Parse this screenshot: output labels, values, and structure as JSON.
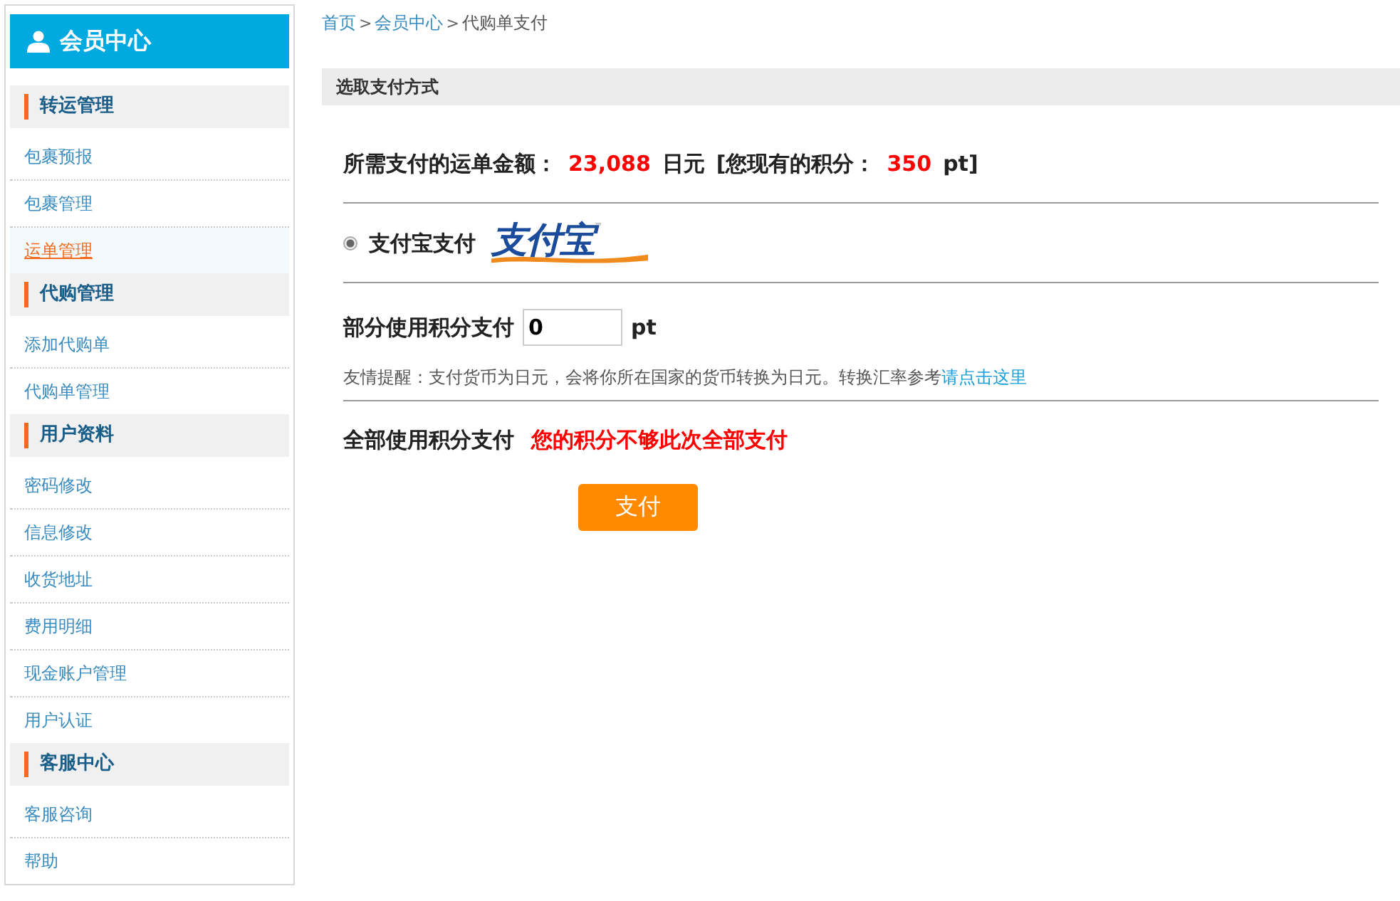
{
  "sidebar": {
    "title": "会员中心",
    "sections": [
      {
        "title": "转运管理",
        "items": [
          {
            "label": "包裹预报",
            "selected": false
          },
          {
            "label": "包裹管理",
            "selected": false
          },
          {
            "label": "运单管理",
            "selected": true
          }
        ]
      },
      {
        "title": "代购管理",
        "items": [
          {
            "label": "添加代购单",
            "selected": false
          },
          {
            "label": "代购单管理",
            "selected": false
          }
        ]
      },
      {
        "title": "用户资料",
        "items": [
          {
            "label": "密码修改",
            "selected": false
          },
          {
            "label": "信息修改",
            "selected": false
          },
          {
            "label": "收货地址",
            "selected": false
          },
          {
            "label": "费用明细",
            "selected": false
          },
          {
            "label": "现金账户管理",
            "selected": false
          },
          {
            "label": "用户认证",
            "selected": false
          }
        ]
      },
      {
        "title": "客服中心",
        "items": [
          {
            "label": "客服咨询",
            "selected": false
          },
          {
            "label": "帮助",
            "selected": false
          }
        ]
      }
    ]
  },
  "breadcrumb": [
    {
      "label": "首页",
      "kind": "link"
    },
    {
      "label": ">",
      "kind": "sep"
    },
    {
      "label": "会员中心",
      "kind": "link"
    },
    {
      "label": ">",
      "kind": "sep"
    },
    {
      "label": "代购单支付",
      "kind": "current"
    }
  ],
  "panel": {
    "title": "选取支付方式",
    "amount": {
      "label": "所需支付的运单金额：",
      "value": "23,088",
      "unit": "日元",
      "points_label": "[您现有的积分：",
      "points": "350",
      "points_unit": "pt]"
    },
    "alipay": {
      "label": "支付宝支付",
      "selected": true,
      "logo": "支付宝",
      "logo_mark": "™"
    },
    "partial": {
      "label": "部分使用积分支付",
      "value": "0",
      "unit": "pt"
    },
    "hint": {
      "text": "友情提醒：支付货币为日元，会将你所在国家的货币转换为日元。转换汇率参考",
      "link": "请点击这里"
    },
    "full": {
      "label": "全部使用积分支付",
      "warning": "您的积分不够此次全部支付"
    },
    "button": "支付"
  }
}
